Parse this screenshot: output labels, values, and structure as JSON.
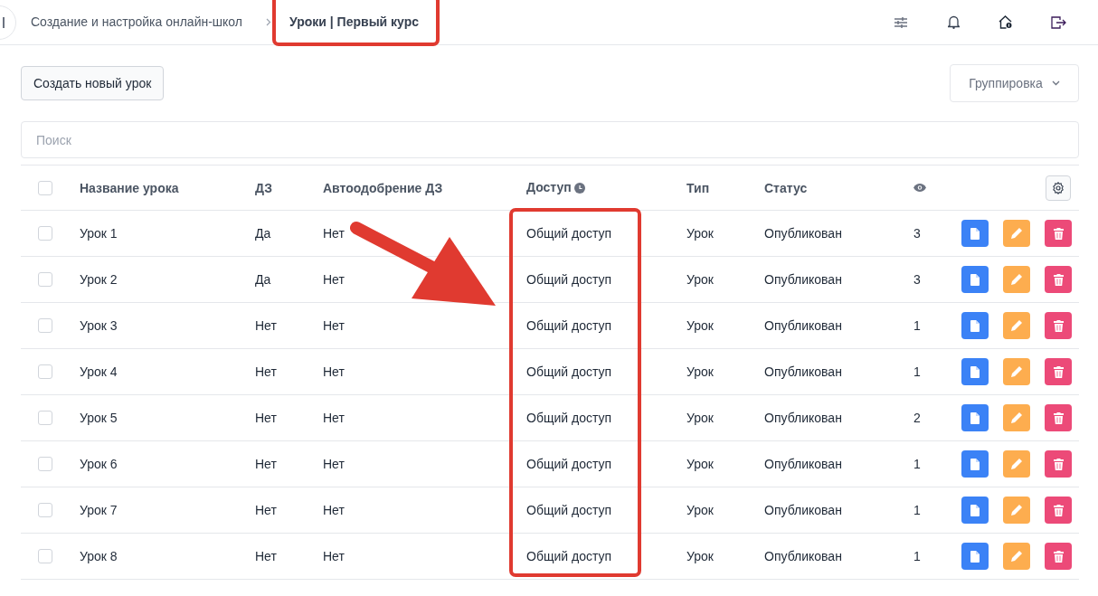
{
  "breadcrumbs": [
    {
      "label": "Создание и настройка онлайн-школ",
      "current": false
    },
    {
      "label": "Уроки | Первый курс",
      "current": true
    }
  ],
  "toolbar": {
    "create_button": "Создать новый урок",
    "grouping": "Группировка"
  },
  "search": {
    "placeholder": "Поиск"
  },
  "table": {
    "select_all_checked": false,
    "columns": [
      "Название урока",
      "ДЗ",
      "Автоодобрение ДЗ",
      "Доступ",
      "Тип",
      "Статус"
    ],
    "rows": [
      {
        "checked": false,
        "name": "Урок 1",
        "homework": "Да",
        "auto_approve": "Нет",
        "access": "Общий доступ",
        "type": "Урок",
        "status": "Опубликован",
        "views": "3"
      },
      {
        "checked": false,
        "name": "Урок 2",
        "homework": "Да",
        "auto_approve": "Нет",
        "access": "Общий доступ",
        "type": "Урок",
        "status": "Опубликован",
        "views": "3"
      },
      {
        "checked": false,
        "name": "Урок 3",
        "homework": "Нет",
        "auto_approve": "Нет",
        "access": "Общий доступ",
        "type": "Урок",
        "status": "Опубликован",
        "views": "1"
      },
      {
        "checked": false,
        "name": "Урок 4",
        "homework": "Нет",
        "auto_approve": "Нет",
        "access": "Общий доступ",
        "type": "Урок",
        "status": "Опубликован",
        "views": "1"
      },
      {
        "checked": false,
        "name": "Урок 5",
        "homework": "Нет",
        "auto_approve": "Нет",
        "access": "Общий доступ",
        "type": "Урок",
        "status": "Опубликован",
        "views": "2"
      },
      {
        "checked": false,
        "name": "Урок 6",
        "homework": "Нет",
        "auto_approve": "Нет",
        "access": "Общий доступ",
        "type": "Урок",
        "status": "Опубликован",
        "views": "1"
      },
      {
        "checked": false,
        "name": "Урок 7",
        "homework": "Нет",
        "auto_approve": "Нет",
        "access": "Общий доступ",
        "type": "Урок",
        "status": "Опубликован",
        "views": "1"
      },
      {
        "checked": false,
        "name": "Урок 8",
        "homework": "Нет",
        "auto_approve": "Нет",
        "access": "Общий доступ",
        "type": "Урок",
        "status": "Опубликован",
        "views": "1"
      }
    ]
  }
}
